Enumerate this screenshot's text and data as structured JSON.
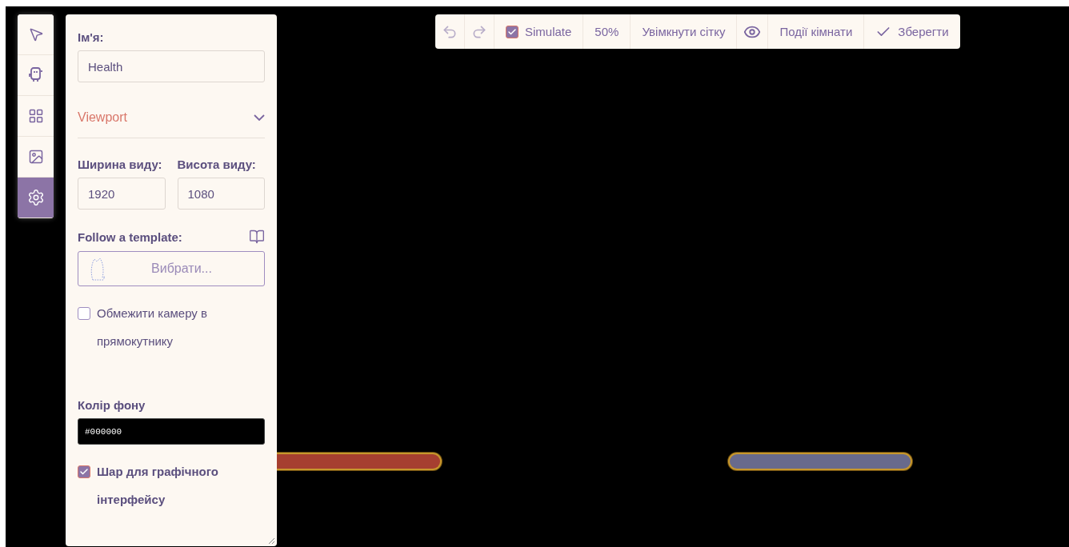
{
  "tools": [
    {
      "kind": "pointer",
      "selected": false
    },
    {
      "kind": "robot",
      "selected": false
    },
    {
      "kind": "grid",
      "selected": false
    },
    {
      "kind": "image",
      "selected": false
    },
    {
      "kind": "settings",
      "selected": true
    }
  ],
  "panel": {
    "name_label": "Ім'я:",
    "name_value": "Health",
    "section": {
      "title": "Viewport",
      "expanded": true
    },
    "width_label": "Ширина виду:",
    "width_value": "1920",
    "height_label": "Висота виду:",
    "height_value": "1080",
    "template_label": "Follow a template:",
    "template_button": "Вибрати...",
    "restrict_camera": {
      "label": "Обмежити камеру в прямокутнику",
      "checked": false
    },
    "background_label": "Колір фону",
    "background_value": "#000000",
    "ui_layer": {
      "label": "Шар для графічного інтерфейсу",
      "checked": true
    }
  },
  "toolbar": [
    {
      "kind": "undo",
      "disabled": true
    },
    {
      "kind": "redo",
      "disabled": true
    },
    {
      "kind": "checkbox",
      "label": "Simulate",
      "checked": true
    },
    {
      "kind": "text",
      "label": "50%"
    },
    {
      "kind": "text",
      "label": "Увімкнути сітку"
    },
    {
      "kind": "eye"
    },
    {
      "kind": "text",
      "label": "Події кімнати"
    },
    {
      "kind": "save",
      "label": "Зберегти"
    }
  ],
  "scene": {
    "bars": [
      {
        "color": "#a63f30"
      },
      {
        "color": "#686a8c"
      }
    ]
  }
}
